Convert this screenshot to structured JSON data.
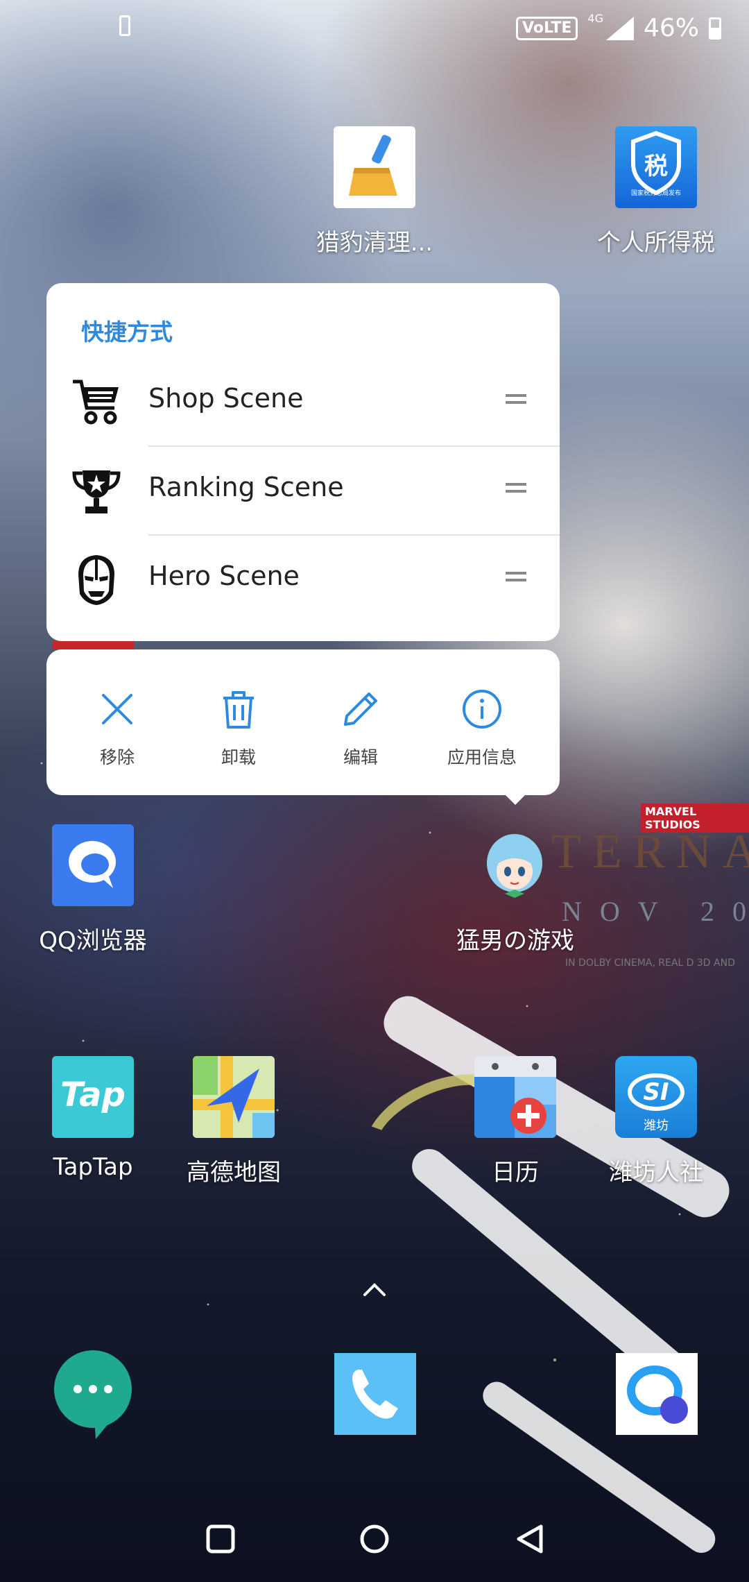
{
  "status_bar": {
    "volte": "VoLTE",
    "network": "4G",
    "battery_text": "46%"
  },
  "home_apps": [
    {
      "label": "猎豹清理..."
    },
    {
      "label": "个人所得税"
    },
    {
      "label": "QQ浏览器"
    },
    {
      "label": "猛男の游戏"
    },
    {
      "label": "TapTap"
    },
    {
      "label": "高德地图"
    },
    {
      "label": "日历"
    },
    {
      "label": "潍坊人社"
    }
  ],
  "icon_text": {
    "tax": "税",
    "tax_sub": "国家税务总局发布",
    "taptap": "Tap",
    "si": "SI",
    "weifang": "潍坊"
  },
  "shortcut_panel": {
    "title": "快捷方式",
    "items": [
      {
        "label": "Shop Scene",
        "icon": "shopping-cart-icon"
      },
      {
        "label": "Ranking Scene",
        "icon": "trophy-icon"
      },
      {
        "label": "Hero Scene",
        "icon": "iron-man-helmet-icon"
      }
    ]
  },
  "actions": [
    {
      "label": "移除",
      "icon": "close-icon"
    },
    {
      "label": "卸载",
      "icon": "trash-icon"
    },
    {
      "label": "编辑",
      "icon": "pencil-icon"
    },
    {
      "label": "应用信息",
      "icon": "info-icon"
    }
  ],
  "wallpaper_text": {
    "studio": "MARVEL STUDIOS",
    "title": "TERNA",
    "date": "NOV 20",
    "credits": "IN DOLBY CINEMA, REAL D 3D AND"
  },
  "colors": {
    "accent": "#2d8ae0",
    "icon_blue": "#3a8ee6"
  }
}
